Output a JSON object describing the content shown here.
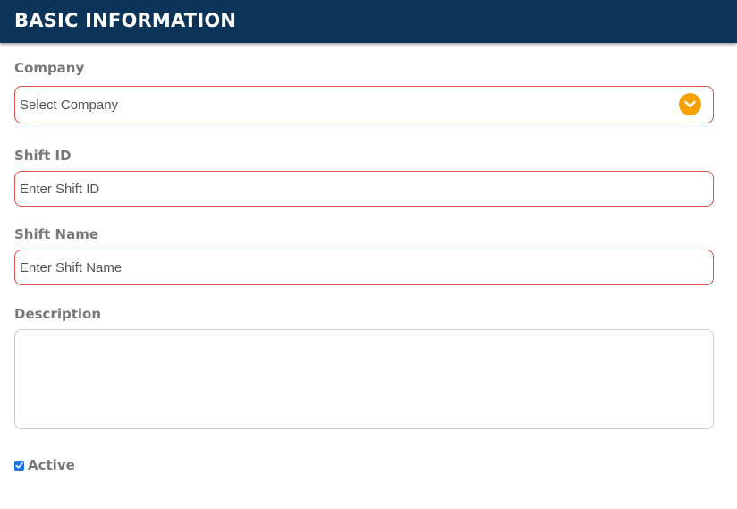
{
  "header": {
    "title": "BASIC INFORMATION"
  },
  "form": {
    "company": {
      "label": "Company",
      "selected_value": "Select Company",
      "icon": "chevron-down-icon"
    },
    "shift_id": {
      "label": "Shift ID",
      "placeholder": "Enter Shift ID"
    },
    "shift_name": {
      "label": "Shift Name",
      "placeholder": "Enter Shift Name"
    },
    "description": {
      "label": "Description",
      "value": ""
    },
    "active": {
      "label": "Active",
      "checked": true
    }
  },
  "colors": {
    "header_bg": "#0c3458",
    "header_text": "#ffffff",
    "label_text": "#777777",
    "required_border": "#d9534f",
    "neutral_border": "#cccccc",
    "accent_orange": "#f5a200",
    "checkbox_blue": "#1a73e8"
  }
}
